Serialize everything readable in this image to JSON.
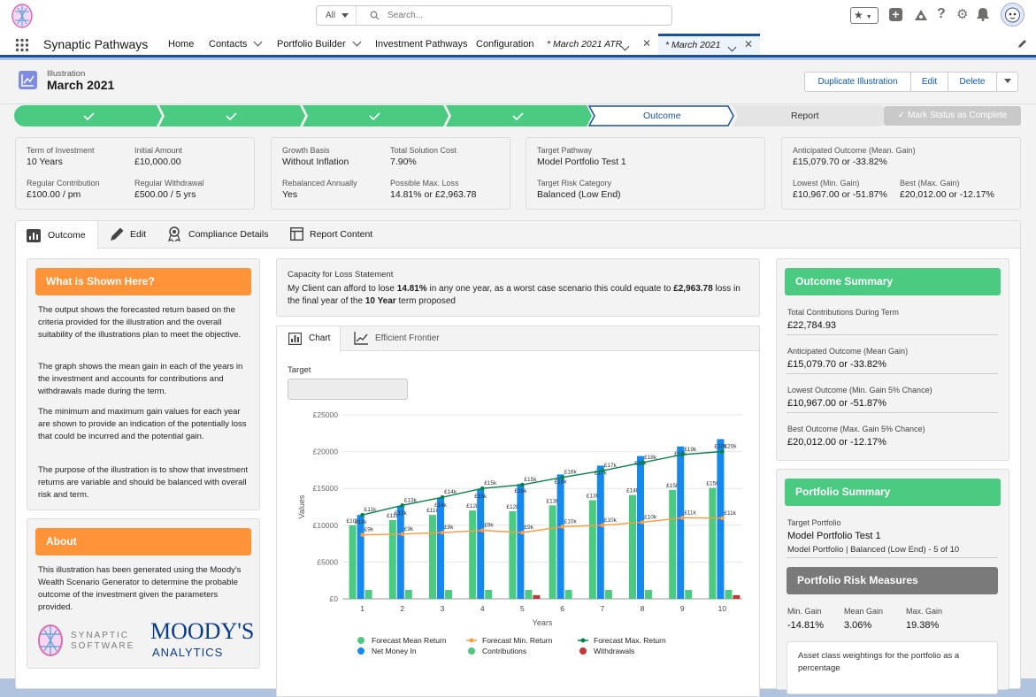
{
  "search": {
    "scope": "All",
    "placeholder": "Search..."
  },
  "nav": {
    "app_name": "Synaptic Pathways",
    "items": [
      "Home",
      "Contacts",
      "Portfolio Builder",
      "Investment Pathways",
      "Configuration"
    ],
    "tabs": [
      "* March 2021 ATR",
      "* March 2021"
    ]
  },
  "header": {
    "object_type": "Illustration",
    "title": "March 2021",
    "buttons": {
      "duplicate": "Duplicate Illustration",
      "edit": "Edit",
      "delete": "Delete"
    }
  },
  "path": {
    "current": "Outcome",
    "next": "Report",
    "mark_complete": "Mark Status as Complete"
  },
  "summary_cards": [
    [
      {
        "label": "Term of Investment",
        "value": "10 Years"
      },
      {
        "label": "Initial Amount",
        "value": "£10,000.00"
      },
      {
        "label": "Regular Contribution",
        "value": "£100.00 / pm"
      },
      {
        "label": "Regular Withdrawal",
        "value": "£500.00 / 5 yrs"
      }
    ],
    [
      {
        "label": "Growth Basis",
        "value": "Without Inflation"
      },
      {
        "label": "Total Solution Cost",
        "value": "7.90%"
      },
      {
        "label": "Rebalanced Annually",
        "value": "Yes"
      },
      {
        "label": "Possible Max. Loss",
        "value": "14.81% or £2,963.78"
      }
    ],
    [
      {
        "label": "Target Pathway",
        "value": "Model Portfolio Test 1"
      },
      {
        "label": "Target Risk Category",
        "value": "Balanced (Low End)"
      }
    ],
    [
      {
        "label": "Anticipated Outcome (Mean. Gain)",
        "value": "£15,079.70 or -33.82%"
      },
      {
        "label": "Lowest (Min. Gain)",
        "value": "£10,967.00 or -51.87%"
      },
      {
        "label": "Best (Max. Gain)",
        "value": "£20,012.00 or -12.17%"
      }
    ]
  ],
  "tabs": {
    "outcome": "Outcome",
    "edit": "Edit",
    "compliance": "Compliance Details",
    "report": "Report Content"
  },
  "what_shown": {
    "title": "What is Shown Here?",
    "paragraphs": [
      "The output shows the forecasted return based on the criteria provided for the illustration and the overall suitability of the illustrations plan to meet the objective.",
      "The graph shows the mean gain in each of the years in the investment and accounts for contributions and withdrawals made during the term.",
      "The minimum and maximum gain values for each year are shown to provide an indication of the potentially loss that could be incurred and the potential gain.",
      "The purpose of the illustration is to show that investment returns are variable and should be balanced with overall risk and term."
    ]
  },
  "about": {
    "title": "About",
    "text": "This illustration has been generated using the Moody's Wealth Scenario Generator to determine the probable outcome of the investment given the parameters provided.",
    "logo1_line1": "SYNAPTIC",
    "logo1_line2": "SOFTWARE",
    "logo2_line1": "MOODY'S",
    "logo2_line2": "ANALYTICS"
  },
  "capacity": {
    "title": "Capacity for Loss Statement",
    "t1": "My Client can afford to lose ",
    "b1": "14.81%",
    "t2": " in any one year, as a worst case scenario this could equate to ",
    "b2": "£2,963.78",
    "t3": " loss in the final year of the ",
    "b3": "10 Year",
    "t4": " term proposed"
  },
  "chart_tabs": {
    "chart": "Chart",
    "frontier": "Efficient Frontier"
  },
  "target_label": "Target",
  "chart_data": {
    "type": "bar",
    "categories": [
      "1",
      "2",
      "3",
      "4",
      "5",
      "6",
      "7",
      "8",
      "9",
      "10"
    ],
    "xlabel": "Years",
    "ylabel": "Values",
    "ylim": [
      0,
      25000
    ],
    "yticks": [
      "£0",
      "£5000",
      "£10000",
      "£15000",
      "£20000",
      "£25000"
    ],
    "series": [
      {
        "name": "Forecast Mean Return",
        "kind": "bar",
        "color": "#4bca81",
        "values": [
          10000,
          10700,
          11400,
          12000,
          11900,
          12700,
          13400,
          14100,
          14800,
          15080
        ],
        "labels": [
          "£10k",
          "£11k",
          "£11k",
          "£12k",
          "£12k",
          "£13k",
          "£13k",
          "£14k",
          "£15k",
          "£15k"
        ]
      },
      {
        "name": "Net Money In",
        "kind": "bar",
        "color": "#1589ee",
        "values": [
          11400,
          12600,
          13700,
          14900,
          15600,
          16900,
          18100,
          19400,
          20700,
          21700
        ],
        "labels": [
          "£11k",
          "£13k",
          "£14k",
          "£15k",
          "£15k",
          "£16k",
          "£17k",
          "£18k",
          "£10k",
          "£10k"
        ]
      },
      {
        "name": "Contributions",
        "kind": "bar",
        "color": "#4bca81",
        "values": [
          1200,
          1200,
          1200,
          1200,
          1200,
          1200,
          1200,
          1200,
          1200,
          1200
        ]
      },
      {
        "name": "Withdrawals",
        "kind": "bar",
        "color": "#c23934",
        "values": [
          0,
          0,
          0,
          0,
          500,
          0,
          0,
          0,
          0,
          500
        ]
      },
      {
        "name": "Forecast Min. Return",
        "kind": "line",
        "color": "#ff9a3c",
        "values": [
          8700,
          8800,
          9000,
          9300,
          9000,
          9800,
          10000,
          10400,
          11000,
          10967
        ],
        "labels": [
          "£9k",
          "£9k",
          "£9k",
          "£9k",
          "£9k",
          "£10k",
          "£10k",
          "£10k",
          "£11k",
          "£11k"
        ]
      },
      {
        "name": "Forecast Max. Return",
        "kind": "line",
        "color": "#04844b",
        "values": [
          11400,
          12700,
          13800,
          15000,
          15500,
          16500,
          17400,
          18500,
          19600,
          20012
        ],
        "labels": [
          "£11k",
          "£13k",
          "£14k",
          "£15k",
          "£15k",
          "£16k",
          "£17k",
          "£18k",
          "£19k",
          "£20k"
        ]
      }
    ],
    "legend": [
      "Forecast Mean Return",
      "Forecast Min. Return",
      "Forecast Max. Return",
      "Net Money In",
      "Contributions",
      "Withdrawals"
    ]
  },
  "outcome_summary": {
    "title": "Outcome Summary",
    "rows": [
      {
        "label": "Total Contributions During Term",
        "value": "£22,784.93"
      },
      {
        "label": "Anticipated Outcome (Mean Gain)",
        "value": "£15,079.70 or -33.82%"
      },
      {
        "label": "Lowest Outcome (Min. Gain 5% Chance)",
        "value": "£10,967.00 or -51.87%"
      },
      {
        "label": "Best Outcome (Max. Gain 5% Chance)",
        "value": "£20,012.00 or -12.17%"
      }
    ]
  },
  "portfolio_summary": {
    "title": "Portfolio Summary",
    "target_label": "Target Portfolio",
    "target_name": "Model Portfolio Test 1",
    "target_desc": "Model Portfolio | Balanced (Low End) - 5 of 10"
  },
  "risk": {
    "title": "Portfolio Risk Measures",
    "measures": [
      {
        "label": "Min. Gain",
        "value": "-14.81%"
      },
      {
        "label": "Mean Gain",
        "value": "3.06%"
      },
      {
        "label": "Max. Gain",
        "value": "19.38%"
      }
    ],
    "asset_text": "Asset class weightings for the portfolio as a percentage"
  }
}
